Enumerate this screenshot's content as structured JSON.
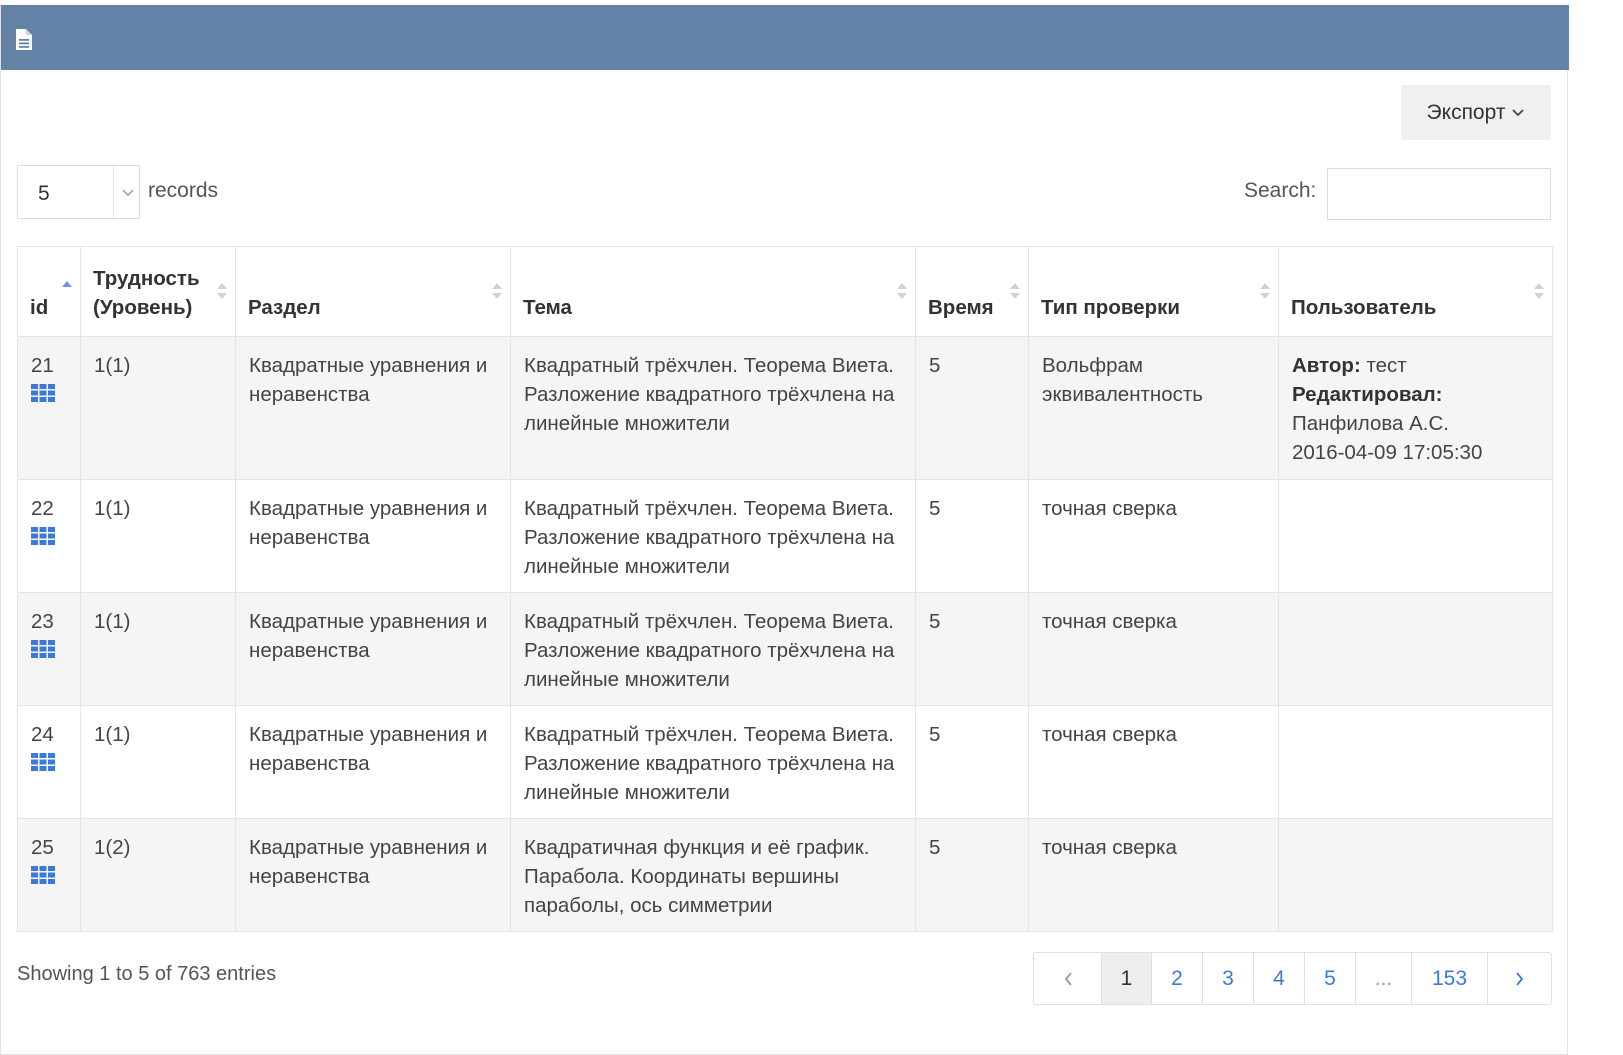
{
  "export": {
    "label": "Экспорт"
  },
  "length": {
    "value": "5",
    "suffix": "records"
  },
  "search": {
    "label": "Search:",
    "placeholder": ""
  },
  "table": {
    "columns": [
      "id",
      "Трудность (Уровень)",
      "Раздел",
      "Тема",
      "Время",
      "Тип проверки",
      "Пользователь"
    ],
    "rows": [
      {
        "id": "21",
        "difficulty": "1(1)",
        "section": "Квадратные уравнения и неравенства",
        "topic": "Квадратный трёхчлен. Теорема Виета. Разложение квадратного трёхчлена на линейные множители",
        "time": "5",
        "check": "Вольфрам эквивалентность",
        "author_label": "Автор:",
        "author": "тест",
        "editor_label": "Редактировал:",
        "editor": "Панфилова А.С.",
        "edited": "2016-04-09 17:05:30"
      },
      {
        "id": "22",
        "difficulty": "1(1)",
        "section": "Квадратные уравнения и неравенства",
        "topic": "Квадратный трёхчлен. Теорема Виета. Разложение квадратного трёхчлена на линейные множители",
        "time": "5",
        "check": "точная сверка"
      },
      {
        "id": "23",
        "difficulty": "1(1)",
        "section": "Квадратные уравнения и неравенства",
        "topic": "Квадратный трёхчлен. Теорема Виета. Разложение квадратного трёхчлена на линейные множители",
        "time": "5",
        "check": "точная сверка"
      },
      {
        "id": "24",
        "difficulty": "1(1)",
        "section": "Квадратные уравнения и неравенства",
        "topic": "Квадратный трёхчлен. Теорема Виета. Разложение квадратного трёхчлена на линейные множители",
        "time": "5",
        "check": "точная сверка"
      },
      {
        "id": "25",
        "difficulty": "1(2)",
        "section": "Квадратные уравнения и неравенства",
        "topic": "Квадратичная функция и её график. Парабола. Координаты вершины параболы, ось симметрии",
        "time": "5",
        "check": "точная сверка"
      }
    ]
  },
  "info": "Showing 1 to 5 of 763 entries",
  "pagination": {
    "pages": [
      "1",
      "2",
      "3",
      "4",
      "5",
      "...",
      "153"
    ]
  },
  "colors": {
    "topbar": "#6482a5",
    "link": "#3b7ad8",
    "stripe": "#f5f5f5"
  },
  "icons": {
    "header": "file-text-icon",
    "row": "grid-icon",
    "sort": "sort-icon"
  }
}
